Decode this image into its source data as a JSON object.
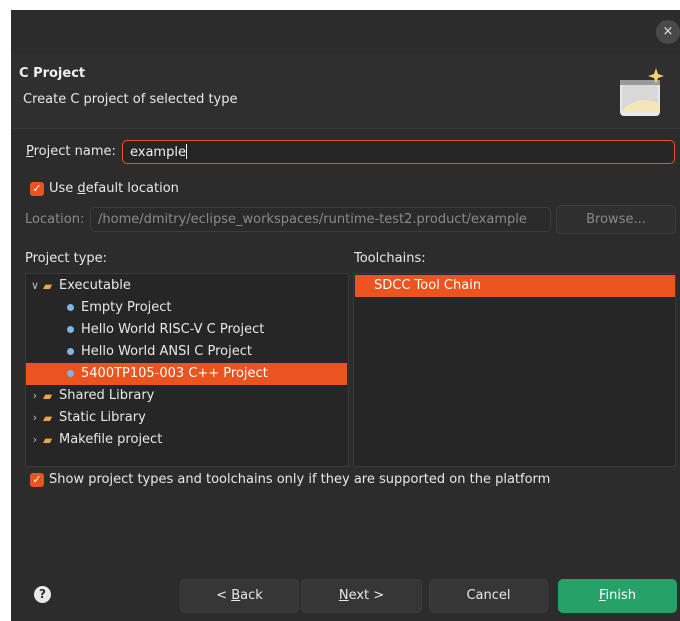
{
  "titlebar": {
    "close_glyph": "×"
  },
  "header": {
    "title": "C Project",
    "description": "Create C project of selected type",
    "wizard_icon": "wizard-banner-icon"
  },
  "project_name": {
    "label_mnemonic": "P",
    "label_rest": "roject name:",
    "value": "example"
  },
  "default_location": {
    "checked": true,
    "label_pre": "Use ",
    "label_mnemonic": "d",
    "label_post": "efault location"
  },
  "location": {
    "label": "Location:",
    "value": "/home/dmitry/eclipse_workspaces/runtime-test2.product/example",
    "browse_label": "Browse..."
  },
  "project_type": {
    "label": "Project type:",
    "items": [
      {
        "label": "Executable",
        "kind": "folder",
        "expanded": true,
        "selected": false
      },
      {
        "label": "Empty Project",
        "kind": "item",
        "selected": false
      },
      {
        "label": "Hello World RISC-V C Project",
        "kind": "item",
        "selected": false
      },
      {
        "label": "Hello World ANSI C Project",
        "kind": "item",
        "selected": false
      },
      {
        "label": "5400TP105-003 C++ Project",
        "kind": "item",
        "selected": true
      },
      {
        "label": "Shared Library",
        "kind": "folder",
        "expanded": false,
        "selected": false
      },
      {
        "label": "Static Library",
        "kind": "folder",
        "expanded": false,
        "selected": false
      },
      {
        "label": "Makefile project",
        "kind": "folder",
        "expanded": false,
        "selected": false
      }
    ]
  },
  "toolchains": {
    "label": "Toolchains:",
    "items": [
      {
        "label": "SDCC Tool Chain",
        "selected": true
      }
    ]
  },
  "filter": {
    "checked": true,
    "label": "Show project types and toolchains only if they are supported on the platform"
  },
  "footer": {
    "help_glyph": "?",
    "back_pre": "< ",
    "back_mnemonic": "B",
    "back_post": "ack",
    "next_mnemonic": "N",
    "next_post": "ext >",
    "cancel_label": "Cancel",
    "finish_mnemonic": "F",
    "finish_post": "inish"
  },
  "colors": {
    "accent": "#e95420",
    "finish": "#26a269",
    "background": "#2c2c2c"
  }
}
